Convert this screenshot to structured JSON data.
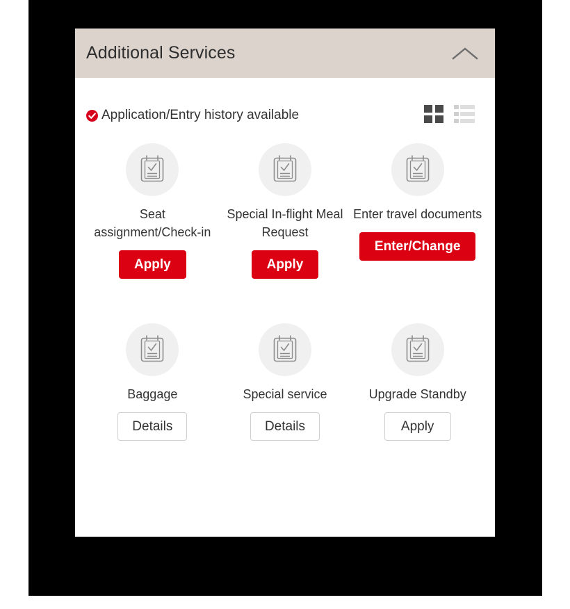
{
  "card": {
    "header": {
      "title": "Additional Services",
      "collapse_icon": "chevron-up-icon"
    },
    "status": {
      "icon": "check-circle-icon",
      "text": "Application/Entry history available"
    },
    "view_toggles": [
      {
        "name": "grid-view-icon",
        "label": "Grid view",
        "active": true
      },
      {
        "name": "list-view-icon",
        "label": "List view",
        "active": false
      }
    ],
    "tiles": [
      {
        "icon": "clipboard-check-icon",
        "label": "Seat assignment/Check-in",
        "action": {
          "label": "Apply",
          "style": "primary"
        }
      },
      {
        "icon": "clipboard-check-icon",
        "label": "Special In-flight Meal Request",
        "action": {
          "label": "Apply",
          "style": "primary"
        }
      },
      {
        "icon": "clipboard-check-icon",
        "label": "Enter travel documents",
        "action": {
          "label": "Enter/Change",
          "style": "primary"
        }
      },
      {
        "icon": "clipboard-check-icon",
        "label": "Baggage",
        "action": {
          "label": "Details",
          "style": "outline"
        }
      },
      {
        "icon": "clipboard-check-icon",
        "label": "Special service",
        "action": {
          "label": "Details",
          "style": "outline"
        }
      },
      {
        "icon": "clipboard-check-icon",
        "label": "Upgrade Standby",
        "action": {
          "label": "Apply",
          "style": "outline"
        }
      }
    ]
  },
  "colors": {
    "header_background": "#dcd3cd",
    "accent_red": "#dc0013",
    "text": "#333333",
    "icon_circle": "#f0f0f0",
    "grid_icon_active": "#4a4a4a",
    "list_icon_inactive": "#d6d6d6",
    "outline_border": "#cfcfcf",
    "backdrop": "#000000"
  }
}
